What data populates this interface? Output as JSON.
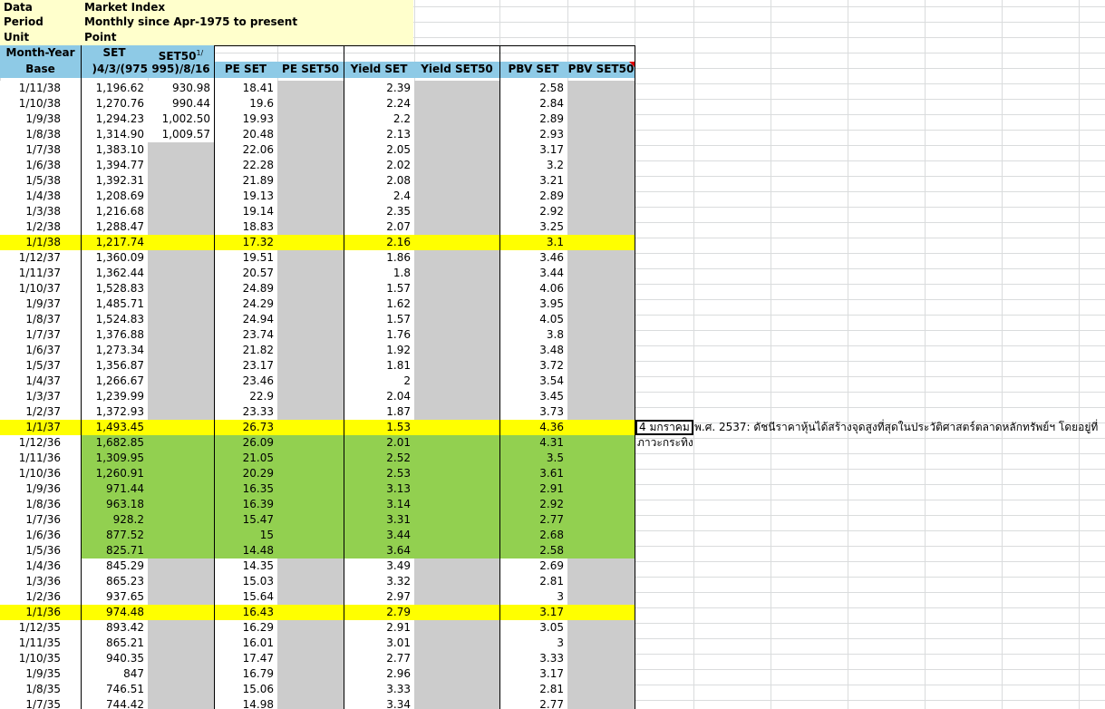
{
  "meta": [
    {
      "label": "Data",
      "value": "Market Index"
    },
    {
      "label": "Period",
      "value": "Monthly since Apr-1975 to present"
    },
    {
      "label": "Unit",
      "value": "Point"
    }
  ],
  "headers": {
    "row1": [
      "Month-Year",
      "SET",
      "SET50",
      "",
      "",
      "",
      "",
      "",
      ""
    ],
    "row1_sup": "1/",
    "row2": [
      "Base",
      "975)/4/3(",
      "995)/8/16",
      "PE SET",
      "PE SET50",
      "Yield SET",
      "Yield SET50",
      "PBV SET",
      "PBV SET50"
    ]
  },
  "rows": [
    {
      "d": "1/11/38",
      "set": "1,196.62",
      "set50": "930.98",
      "pe": "18.41",
      "y": "2.39",
      "pbv": "2.58",
      "hl": ""
    },
    {
      "d": "1/10/38",
      "set": "1,270.76",
      "set50": "990.44",
      "pe": "19.6",
      "y": "2.24",
      "pbv": "2.84",
      "hl": ""
    },
    {
      "d": "1/9/38",
      "set": "1,294.23",
      "set50": "1,002.50",
      "pe": "19.93",
      "y": "2.2",
      "pbv": "2.89",
      "hl": ""
    },
    {
      "d": "1/8/38",
      "set": "1,314.90",
      "set50": "1,009.57",
      "pe": "20.48",
      "y": "2.13",
      "pbv": "2.93",
      "hl": ""
    },
    {
      "d": "1/7/38",
      "set": "1,383.10",
      "set50": "",
      "pe": "22.06",
      "y": "2.05",
      "pbv": "3.17",
      "hl": ""
    },
    {
      "d": "1/6/38",
      "set": "1,394.77",
      "set50": "",
      "pe": "22.28",
      "y": "2.02",
      "pbv": "3.2",
      "hl": ""
    },
    {
      "d": "1/5/38",
      "set": "1,392.31",
      "set50": "",
      "pe": "21.89",
      "y": "2.08",
      "pbv": "3.21",
      "hl": ""
    },
    {
      "d": "1/4/38",
      "set": "1,208.69",
      "set50": "",
      "pe": "19.13",
      "y": "2.4",
      "pbv": "2.89",
      "hl": ""
    },
    {
      "d": "1/3/38",
      "set": "1,216.68",
      "set50": "",
      "pe": "19.14",
      "y": "2.35",
      "pbv": "2.92",
      "hl": ""
    },
    {
      "d": "1/2/38",
      "set": "1,288.47",
      "set50": "",
      "pe": "18.83",
      "y": "2.07",
      "pbv": "3.25",
      "hl": ""
    },
    {
      "d": "1/1/38",
      "set": "1,217.74",
      "set50": "",
      "pe": "17.32",
      "y": "2.16",
      "pbv": "3.1",
      "hl": "yellow"
    },
    {
      "d": "1/12/37",
      "set": "1,360.09",
      "set50": "",
      "pe": "19.51",
      "y": "1.86",
      "pbv": "3.46",
      "hl": ""
    },
    {
      "d": "1/11/37",
      "set": "1,362.44",
      "set50": "",
      "pe": "20.57",
      "y": "1.8",
      "pbv": "3.44",
      "hl": ""
    },
    {
      "d": "1/10/37",
      "set": "1,528.83",
      "set50": "",
      "pe": "24.89",
      "y": "1.57",
      "pbv": "4.06",
      "hl": ""
    },
    {
      "d": "1/9/37",
      "set": "1,485.71",
      "set50": "",
      "pe": "24.29",
      "y": "1.62",
      "pbv": "3.95",
      "hl": ""
    },
    {
      "d": "1/8/37",
      "set": "1,524.83",
      "set50": "",
      "pe": "24.94",
      "y": "1.57",
      "pbv": "4.05",
      "hl": ""
    },
    {
      "d": "1/7/37",
      "set": "1,376.88",
      "set50": "",
      "pe": "23.74",
      "y": "1.76",
      "pbv": "3.8",
      "hl": ""
    },
    {
      "d": "1/6/37",
      "set": "1,273.34",
      "set50": "",
      "pe": "21.82",
      "y": "1.92",
      "pbv": "3.48",
      "hl": ""
    },
    {
      "d": "1/5/37",
      "set": "1,356.87",
      "set50": "",
      "pe": "23.17",
      "y": "1.81",
      "pbv": "3.72",
      "hl": ""
    },
    {
      "d": "1/4/37",
      "set": "1,266.67",
      "set50": "",
      "pe": "23.46",
      "y": "2",
      "pbv": "3.54",
      "hl": ""
    },
    {
      "d": "1/3/37",
      "set": "1,239.99",
      "set50": "",
      "pe": "22.9",
      "y": "2.04",
      "pbv": "3.45",
      "hl": ""
    },
    {
      "d": "1/2/37",
      "set": "1,372.93",
      "set50": "",
      "pe": "23.33",
      "y": "1.87",
      "pbv": "3.73",
      "hl": ""
    },
    {
      "d": "1/1/37",
      "set": "1,493.45",
      "set50": "",
      "pe": "26.73",
      "y": "1.53",
      "pbv": "4.36",
      "hl": "yellow"
    },
    {
      "d": "1/12/36",
      "set": "1,682.85",
      "set50": "",
      "pe": "26.09",
      "y": "2.01",
      "pbv": "4.31",
      "hl": "green"
    },
    {
      "d": "1/11/36",
      "set": "1,309.95",
      "set50": "",
      "pe": "21.05",
      "y": "2.52",
      "pbv": "3.5",
      "hl": "green"
    },
    {
      "d": "1/10/36",
      "set": "1,260.91",
      "set50": "",
      "pe": "20.29",
      "y": "2.53",
      "pbv": "3.61",
      "hl": "green"
    },
    {
      "d": "1/9/36",
      "set": "971.44",
      "set50": "",
      "pe": "16.35",
      "y": "3.13",
      "pbv": "2.91",
      "hl": "green"
    },
    {
      "d": "1/8/36",
      "set": "963.18",
      "set50": "",
      "pe": "16.39",
      "y": "3.14",
      "pbv": "2.92",
      "hl": "green"
    },
    {
      "d": "1/7/36",
      "set": "928.2",
      "set50": "",
      "pe": "15.47",
      "y": "3.31",
      "pbv": "2.77",
      "hl": "green"
    },
    {
      "d": "1/6/36",
      "set": "877.52",
      "set50": "",
      "pe": "15",
      "y": "3.44",
      "pbv": "2.68",
      "hl": "green"
    },
    {
      "d": "1/5/36",
      "set": "825.71",
      "set50": "",
      "pe": "14.48",
      "y": "3.64",
      "pbv": "2.58",
      "hl": "green"
    },
    {
      "d": "1/4/36",
      "set": "845.29",
      "set50": "",
      "pe": "14.35",
      "y": "3.49",
      "pbv": "2.69",
      "hl": ""
    },
    {
      "d": "1/3/36",
      "set": "865.23",
      "set50": "",
      "pe": "15.03",
      "y": "3.32",
      "pbv": "2.81",
      "hl": ""
    },
    {
      "d": "1/2/36",
      "set": "937.65",
      "set50": "",
      "pe": "15.64",
      "y": "2.97",
      "pbv": "3",
      "hl": ""
    },
    {
      "d": "1/1/36",
      "set": "974.48",
      "set50": "",
      "pe": "16.43",
      "y": "2.79",
      "pbv": "3.17",
      "hl": "yellow"
    },
    {
      "d": "1/12/35",
      "set": "893.42",
      "set50": "",
      "pe": "16.29",
      "y": "2.91",
      "pbv": "3.05",
      "hl": ""
    },
    {
      "d": "1/11/35",
      "set": "865.21",
      "set50": "",
      "pe": "16.01",
      "y": "3.01",
      "pbv": "3",
      "hl": ""
    },
    {
      "d": "1/10/35",
      "set": "940.35",
      "set50": "",
      "pe": "17.47",
      "y": "2.77",
      "pbv": "3.33",
      "hl": ""
    },
    {
      "d": "1/9/35",
      "set": "847",
      "set50": "",
      "pe": "16.79",
      "y": "2.96",
      "pbv": "3.17",
      "hl": ""
    },
    {
      "d": "1/8/35",
      "set": "746.51",
      "set50": "",
      "pe": "15.06",
      "y": "3.33",
      "pbv": "2.81",
      "hl": ""
    },
    {
      "d": "1/7/35",
      "set": "744.42",
      "set50": "",
      "pe": "14.98",
      "y": "3.34",
      "pbv": "2.77",
      "hl": ""
    }
  ],
  "note": {
    "lead": "4 มกราคม",
    "rest": "พ.ศ. 2537: ดัชนีราคาหุ้นได้สร้างจุดสูงที่สุดในประวัติศาสตร์ตลาดหลักทรัพย์ฯ โดยอยู่ที่",
    "line2": "ภาวะกระทิง"
  },
  "colors": {
    "meta_bg": "#ffffcc",
    "header_bg": "#8ecae6",
    "yellow": "#ffff00",
    "green": "#92d050",
    "gray": "#cccccc",
    "grid": "#dadcdd"
  }
}
